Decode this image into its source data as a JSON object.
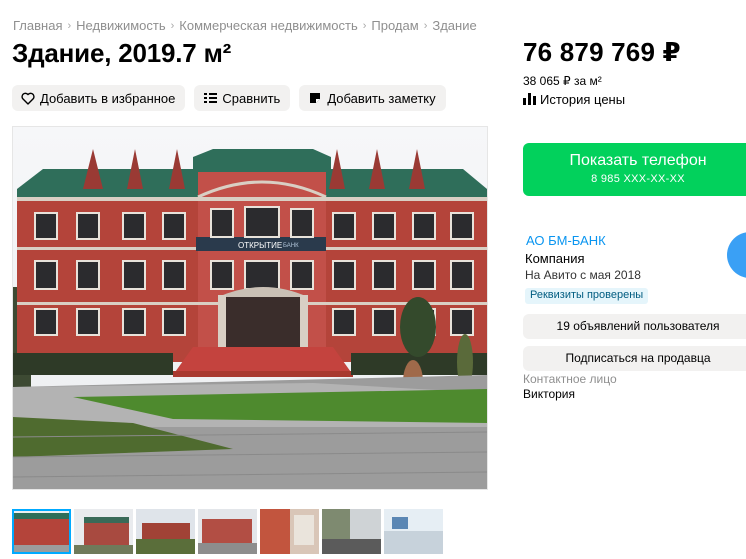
{
  "breadcrumb": [
    "Главная",
    "Недвижимость",
    "Коммерческая недвижимость",
    "Продам",
    "Здание"
  ],
  "title": "Здание, 2019.7 м²",
  "actions": {
    "favorite_label": "Добавить в избранное",
    "compare_label": "Сравнить",
    "note_label": "Добавить заметку"
  },
  "photo": {
    "sign_text": "ОТКРЫТИЕ",
    "sign_small": "БАНК"
  },
  "price": {
    "value": "76 879 769 ₽",
    "per_sqm": "38 065 ₽ за м²",
    "history_label": "История цены"
  },
  "phone": {
    "label": "Показать телефон",
    "masked": "8 985 XXX-XX-XX"
  },
  "seller": {
    "name": "АО БМ-БАНК",
    "type": "Компания",
    "since": "На Авито с мая 2018",
    "verified": "Реквизиты проверены",
    "listings_label": "19 объявлений пользователя",
    "subscribe_label": "Подписаться на продавца",
    "contact_label": "Контактное лицо",
    "contact_name": "Виктория"
  },
  "colors": {
    "accent_green": "#02d15c",
    "link_blue": "#0a95f0",
    "brick": "#b4443a",
    "roof": "#2f6e5a"
  }
}
